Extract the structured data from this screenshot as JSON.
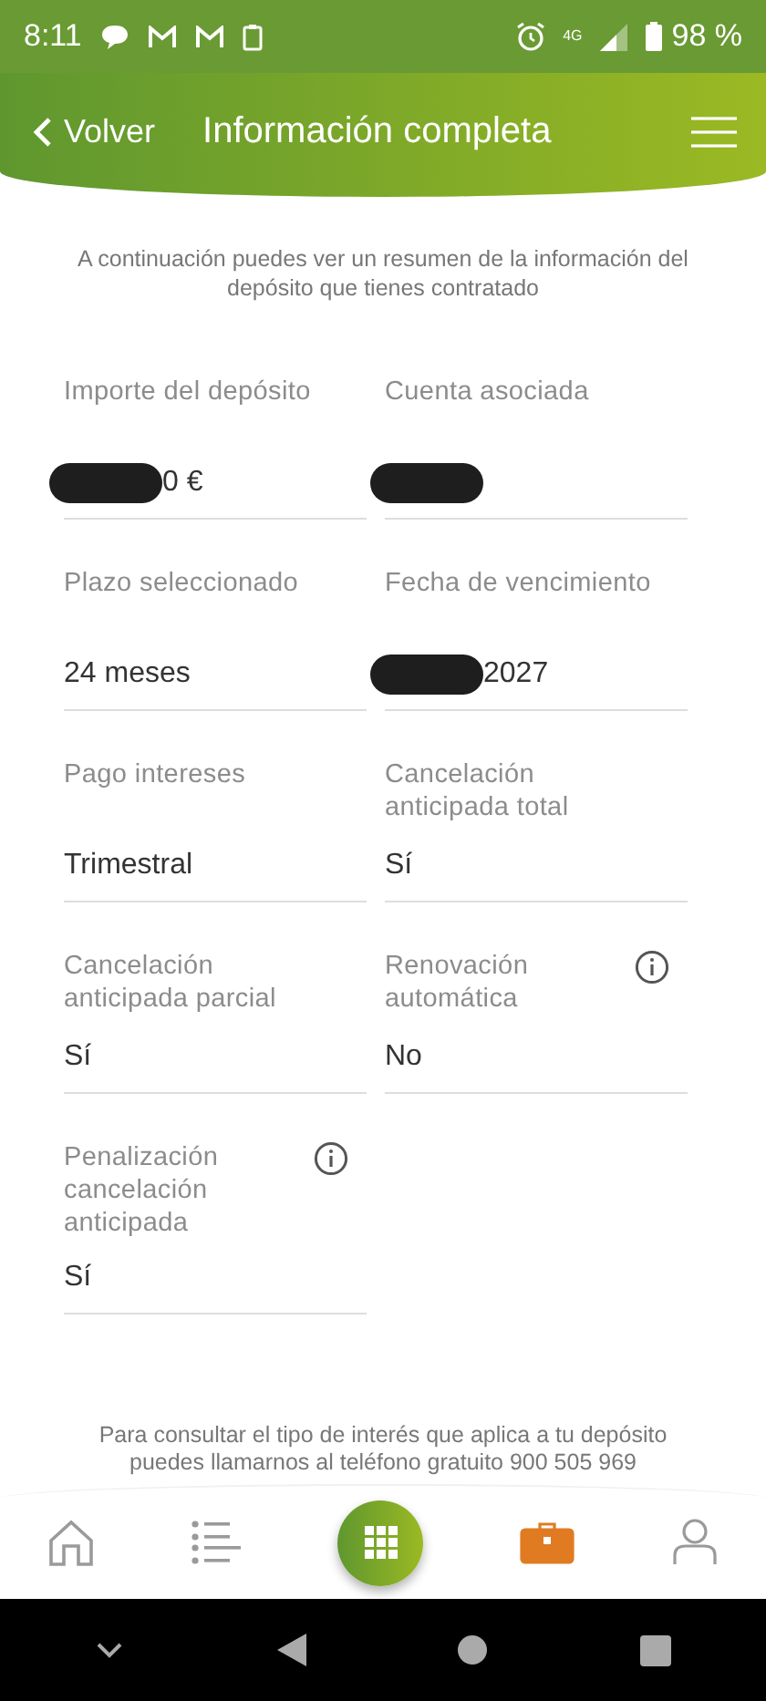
{
  "status_bar": {
    "time": "8:11",
    "network": "4G",
    "battery": "98 %"
  },
  "header": {
    "back": "Volver",
    "title": "Información completa"
  },
  "intro": "A continuación puedes ver un resumen de la información del depósito que tienes contratado",
  "fields": [
    {
      "label": "Importe del depósito",
      "value": "0 €",
      "redacted": true,
      "info": false
    },
    {
      "label": "Cuenta asociada",
      "redacted": true,
      "info": false
    },
    {
      "label": "Plazo seleccionado",
      "value": "24 meses",
      "redacted": false,
      "info": false
    },
    {
      "label": "Fecha de vencimiento",
      "value": "2027",
      "redacted": true,
      "info": false
    },
    {
      "label": "Pago intereses",
      "value": "Trimestral",
      "redacted": false,
      "info": false
    },
    {
      "label": "Cancelación anticipada total",
      "value": "Sí",
      "redacted": false,
      "info": false
    },
    {
      "label": "Cancelación anticipada parcial",
      "value": "Sí",
      "redacted": false,
      "info": false
    },
    {
      "label": "Renovación automática",
      "value": "No",
      "redacted": false,
      "info": true
    },
    {
      "label": "Penalización cancelación anticipada",
      "value": "Sí",
      "redacted": false,
      "info": true
    }
  ],
  "footer_note": "Para consultar el tipo de interés que aplica a tu depósito puedes llamarnos al teléfono gratuito 900 505 969",
  "nav": [
    {
      "kind": "home",
      "selected": false
    },
    {
      "kind": "list",
      "selected": false
    },
    {
      "kind": "grid",
      "selected": false
    },
    {
      "kind": "briefcase",
      "selected": true
    },
    {
      "kind": "user",
      "selected": false
    }
  ]
}
